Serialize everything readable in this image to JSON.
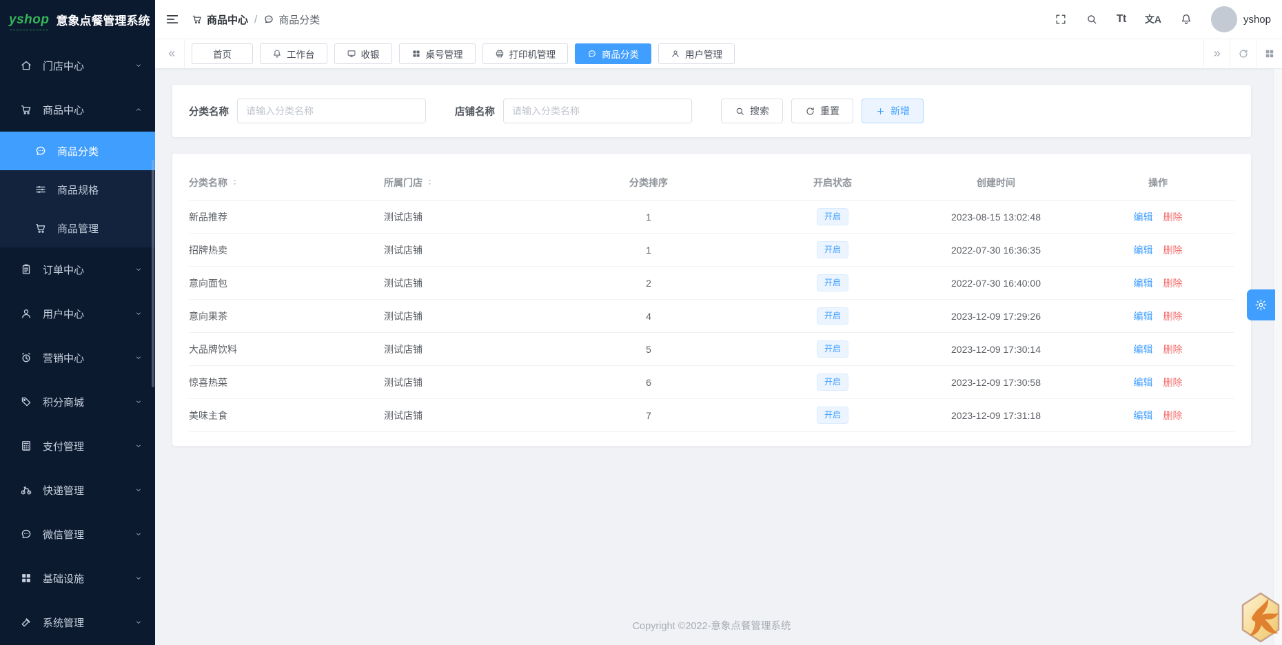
{
  "app": {
    "logo_text": "yshop",
    "title": "意象点餐管理系统"
  },
  "sidebar": {
    "items": [
      {
        "key": "store-center",
        "label": "门店中心",
        "icon": "home"
      },
      {
        "key": "goods-center",
        "label": "商品中心",
        "icon": "cart",
        "expanded": true,
        "children": [
          {
            "key": "goods-category",
            "label": "商品分类",
            "icon": "chat",
            "active": true
          },
          {
            "key": "goods-spec",
            "label": "商品规格",
            "icon": "sliders"
          },
          {
            "key": "goods-manage",
            "label": "商品管理",
            "icon": "cart"
          }
        ]
      },
      {
        "key": "order-center",
        "label": "订单中心",
        "icon": "clipboard"
      },
      {
        "key": "user-center",
        "label": "用户中心",
        "icon": "user"
      },
      {
        "key": "marketing-center",
        "label": "营销中心",
        "icon": "alarm"
      },
      {
        "key": "points-mall",
        "label": "积分商城",
        "icon": "tag"
      },
      {
        "key": "payment-manage",
        "label": "支付管理",
        "icon": "calculator"
      },
      {
        "key": "express-manage",
        "label": "快递管理",
        "icon": "bike"
      },
      {
        "key": "wechat-manage",
        "label": "微信管理",
        "icon": "chat"
      },
      {
        "key": "infrastructure",
        "label": "基础设施",
        "icon": "grid"
      },
      {
        "key": "system-manage",
        "label": "系统管理",
        "icon": "hammer"
      }
    ]
  },
  "header": {
    "breadcrumb_parent": "商品中心",
    "breadcrumb_separator": "/",
    "breadcrumb_current": "商品分类",
    "font_icon_text": "Tt",
    "translate_icon_text": "文A",
    "username": "yshop"
  },
  "tabs": [
    {
      "key": "home",
      "label": "首页"
    },
    {
      "key": "workbench",
      "label": "工作台",
      "icon": "bell"
    },
    {
      "key": "cashier",
      "label": "收银",
      "icon": "monitor"
    },
    {
      "key": "table-manage",
      "label": "桌号管理",
      "icon": "grid"
    },
    {
      "key": "printer-manage",
      "label": "打印机管理",
      "icon": "printer"
    },
    {
      "key": "goods-category",
      "label": "商品分类",
      "icon": "chat",
      "active": true
    },
    {
      "key": "user-manage",
      "label": "用户管理",
      "icon": "user"
    }
  ],
  "filters": {
    "category_label": "分类名称",
    "category_placeholder": "请输入分类名称",
    "store_label": "店铺名称",
    "store_placeholder": "请输入分类名称",
    "search_button": "搜索",
    "reset_button": "重置",
    "add_button": "新增"
  },
  "table": {
    "columns": [
      {
        "label": "分类名称",
        "sortable": true
      },
      {
        "label": "所属门店",
        "sortable": true
      },
      {
        "label": "分类排序"
      },
      {
        "label": "开启状态"
      },
      {
        "label": "创建时间"
      },
      {
        "label": "操作"
      }
    ],
    "rows": [
      {
        "name": "新品推荐",
        "store": "测试店铺",
        "sort": "1",
        "status": "开启",
        "created": "2023-08-15 13:02:48"
      },
      {
        "name": "招牌热卖",
        "store": "测试店铺",
        "sort": "1",
        "status": "开启",
        "created": "2022-07-30 16:36:35"
      },
      {
        "name": "意向面包",
        "store": "测试店铺",
        "sort": "2",
        "status": "开启",
        "created": "2022-07-30 16:40:00"
      },
      {
        "name": "意向果茶",
        "store": "测试店铺",
        "sort": "4",
        "status": "开启",
        "created": "2023-12-09 17:29:26"
      },
      {
        "name": "大品牌饮料",
        "store": "测试店铺",
        "sort": "5",
        "status": "开启",
        "created": "2023-12-09 17:30:14"
      },
      {
        "name": "惊喜热菜",
        "store": "测试店铺",
        "sort": "6",
        "status": "开启",
        "created": "2023-12-09 17:30:58"
      },
      {
        "name": "美味主食",
        "store": "测试店铺",
        "sort": "7",
        "status": "开启",
        "created": "2023-12-09 17:31:18"
      }
    ],
    "edit_label": "编辑",
    "delete_label": "删除"
  },
  "footer": {
    "copyright": "Copyright ©2022-意象点餐管理系统"
  },
  "colors": {
    "primary": "#409eff",
    "danger": "#f56c6c",
    "sidebar_bg": "#0c1a30",
    "submenu_bg": "#13233d",
    "status_pill_bg": "#ecf5ff",
    "status_pill_border": "#d9ecff",
    "logo_green": "#35b558"
  }
}
